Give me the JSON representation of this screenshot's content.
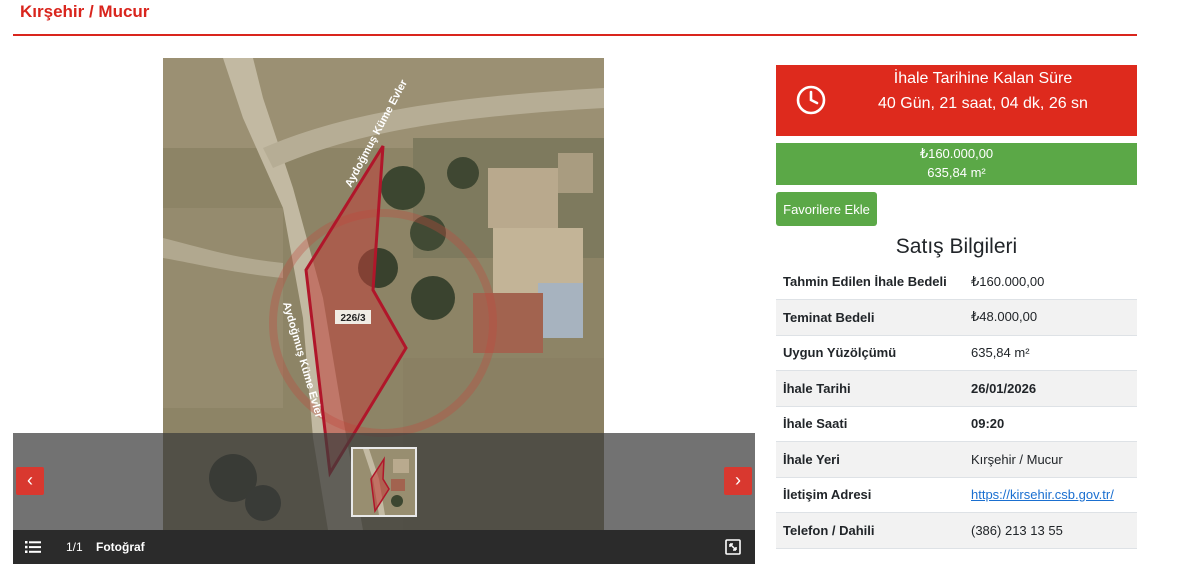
{
  "header": {
    "title": "Kırşehir / Mucur"
  },
  "gallery": {
    "map_parcel_label": "226/3",
    "map_road_label_top": "Aydoğmuş Küme Evler",
    "map_road_label_bottom": "Aydoğmuş Küme Evler",
    "prev_arrow": "‹",
    "next_arrow": "›",
    "counter": "1/1",
    "photo_type": "Fotoğraf",
    "icons": {
      "list": "list-icon",
      "fullscreen": "fullscreen-icon",
      "prev": "chevron-left-icon",
      "next": "chevron-right-icon"
    }
  },
  "countdown": {
    "label": "İhale Tarihine Kalan Süre",
    "value": "40 Gün, 21 saat, 04 dk, 26 sn",
    "icon": "clock-icon",
    "color": "#de2a1d"
  },
  "price": {
    "amount": "₺160.000,00",
    "area": "635,84 m²",
    "color": "#5ba847"
  },
  "favorite_button": {
    "label": "Favorilere Ekle"
  },
  "sale_info": {
    "title": "Satış Bilgileri",
    "rows": [
      {
        "label": "Tahmin Edilen İhale Bedeli",
        "value": "₺160.000,00"
      },
      {
        "label": "Teminat Bedeli",
        "value": "₺48.000,00"
      },
      {
        "label": "Uygun Yüzölçümü",
        "value": "635,84 m²"
      },
      {
        "label": "İhale Tarihi",
        "value": "26/01/2026"
      },
      {
        "label": "İhale Saati",
        "value": "09:20"
      },
      {
        "label": "İhale Yeri",
        "value": "Kırşehir / Mucur"
      },
      {
        "label": "İletişim Adresi",
        "value": "https://kirsehir.csb.gov.tr/"
      },
      {
        "label": "Telefon / Dahili",
        "value": "(386) 213 13 55"
      }
    ]
  }
}
